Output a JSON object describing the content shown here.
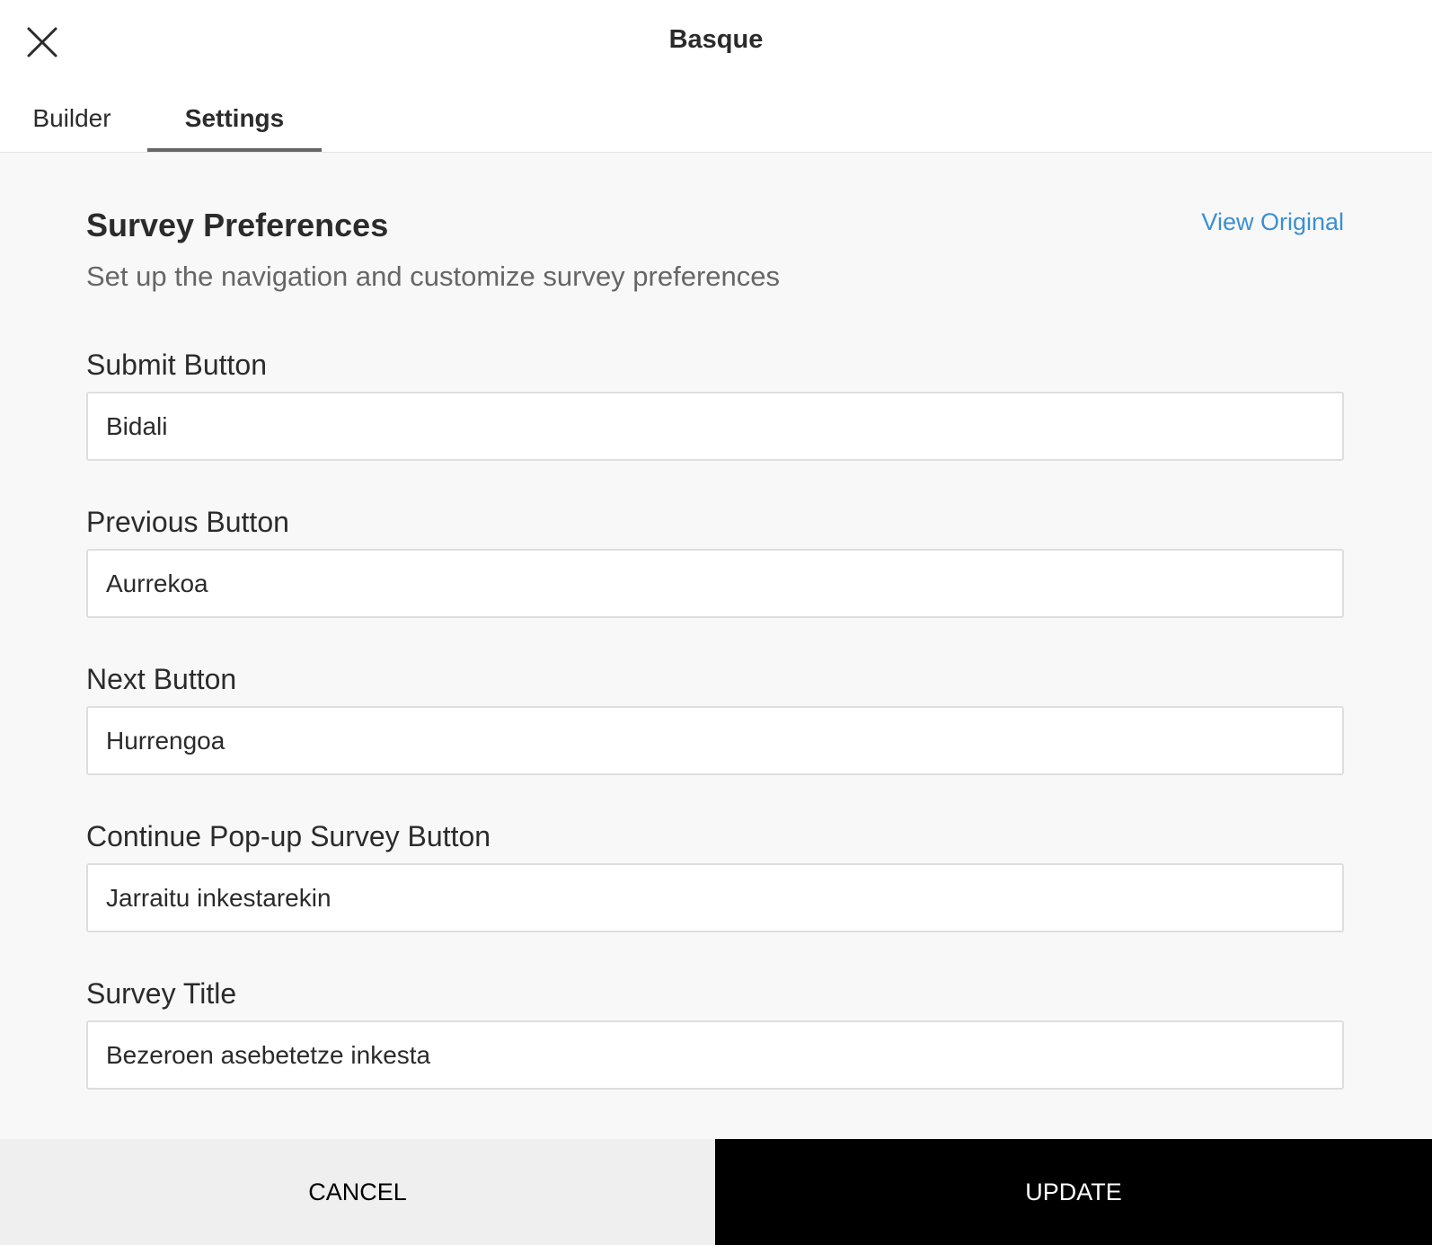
{
  "header": {
    "title": "Basque",
    "close_icon": "close-icon"
  },
  "tabs": [
    {
      "label": "Builder",
      "active": false
    },
    {
      "label": "Settings",
      "active": true
    }
  ],
  "section": {
    "title": "Survey Preferences",
    "subtitle": "Set up the navigation and customize survey preferences",
    "view_original_link": "View Original"
  },
  "fields": [
    {
      "label": "Submit Button",
      "value": "Bidali"
    },
    {
      "label": "Previous Button",
      "value": "Aurrekoa"
    },
    {
      "label": "Next Button",
      "value": "Hurrengoa"
    },
    {
      "label": "Continue Pop-up Survey Button",
      "value": "Jarraitu inkestarekin"
    },
    {
      "label": "Survey Title",
      "value": "Bezeroen asebetetze inkesta"
    }
  ],
  "footer": {
    "cancel_label": "CANCEL",
    "update_label": "UPDATE"
  },
  "colors": {
    "link": "#3a8fd4",
    "primary_button": "#000000",
    "secondary_button": "#efefef",
    "content_background": "#f8f8f8"
  }
}
